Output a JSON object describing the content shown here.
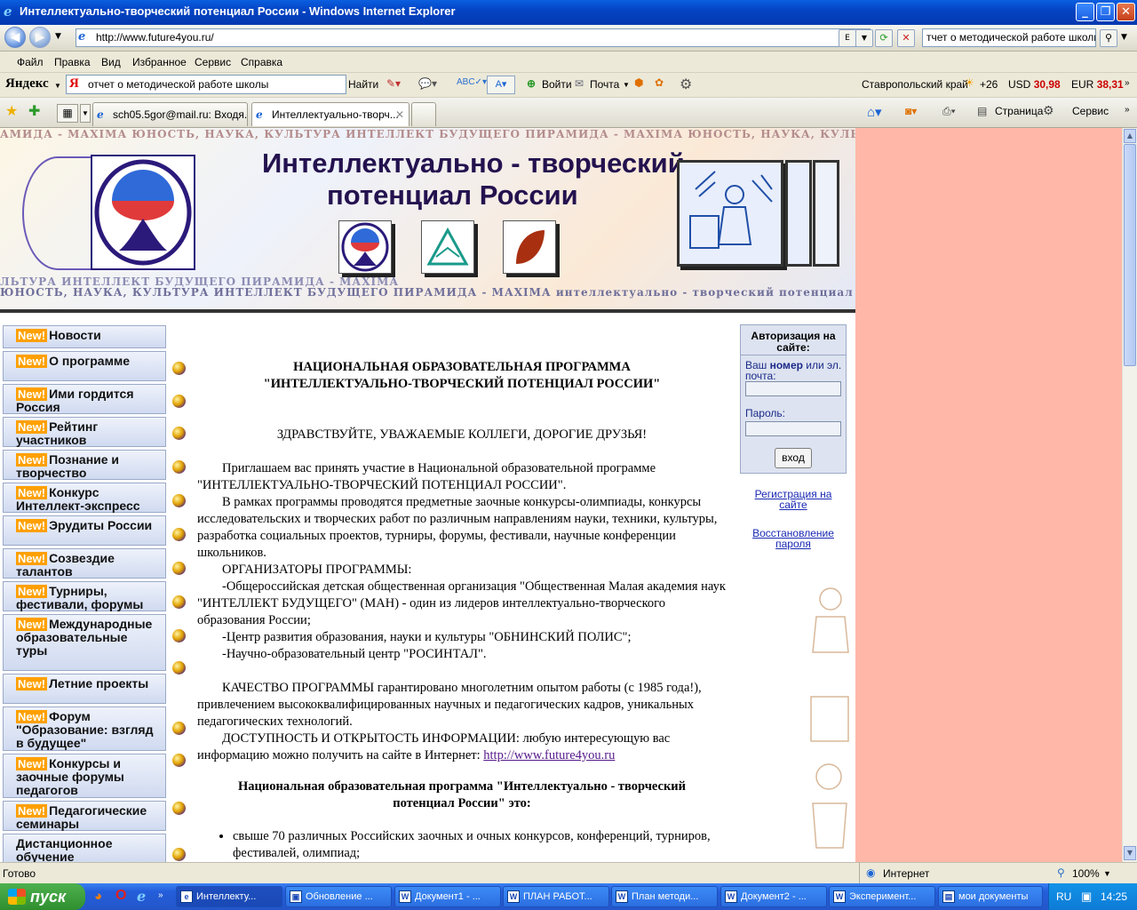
{
  "window": {
    "title": "Интеллектуально-творческий потенциал России - Windows Internet Explorer"
  },
  "address": {
    "url": "http://www.future4you.ru/",
    "search_value": "тчет о методической работе школы"
  },
  "menu": [
    "Файл",
    "Правка",
    "Вид",
    "Избранное",
    "Сервис",
    "Справка"
  ],
  "yandex": {
    "logo": "Яндекс",
    "query": "отчет о методической работе школы",
    "find_label": "Найти",
    "login_label": "Войти",
    "mail_label": "Почта",
    "region": "Ставропольский край",
    "temp": "+26",
    "usd_label": "USD",
    "usd_value": "30,98",
    "eur_label": "EUR",
    "eur_value": "38,31"
  },
  "tabs": [
    {
      "label": "sch05.5gor@mail.ru: Входя..."
    },
    {
      "label": "Интеллектуально-творч..."
    }
  ],
  "command_bar": {
    "page_label": "Страница",
    "tools_label": "Сервис"
  },
  "banner": {
    "title1": "Интеллектуально - творческий",
    "title2": "потенциал России",
    "strip_top": "АМИДА - МАХIМА   ЮНОСТЬ, НАУКА, КУЛЬТУРА   ИНТЕЛЛЕКТ БУДУЩЕГО   ПИРАМИДА - МАХIМА   ЮНОСТЬ, НАУКА, КУЛЬТУРА   ИНТЕЛЛЕКТ БУДУЩЕГО",
    "strip_bottom1": "ЛЬТУРА   ИНТЕЛЛЕКТ БУДУЩЕГО   ПИРАМИДА - МАХIМА",
    "strip_bottom2": "ЮНОСТЬ, НАУКА, КУЛЬТУРА   ИНТЕЛЛЕКТ БУДУЩЕГО   ПИРАМИДА - МАХIМА   интеллектуально - творческий потенциал"
  },
  "left_menu": [
    {
      "new": "New!",
      "label": "Новости"
    },
    {
      "new": "New!",
      "label": "О программе"
    },
    {
      "new": "New!",
      "label": "Ими гордится Россия"
    },
    {
      "new": "New!",
      "label": "Рейтинг участников"
    },
    {
      "new": "New!",
      "label": "Познание и творчество"
    },
    {
      "new": "New!",
      "label": "Конкурс Интеллект-экспресс"
    },
    {
      "new": "New!",
      "label": "Эрудиты России"
    },
    {
      "new": "New!",
      "label": "Созвездие талантов"
    },
    {
      "new": "New!",
      "label": "Турниры, фестивали, форумы"
    },
    {
      "new": "New!",
      "label": "Международные образовательные туры"
    },
    {
      "new": "New!",
      "label": "Летние проекты"
    },
    {
      "new": "New!",
      "label": "Форум \"Образование: взгляд в будущее\""
    },
    {
      "new": "New!",
      "label": "Конкурсы и заочные форумы педагогов"
    },
    {
      "new": "New!",
      "label": "Педагогические семинары"
    },
    {
      "new": "",
      "label": "Дистанционное обучение"
    }
  ],
  "main": {
    "heading1": "НАЦИОНАЛЬНАЯ ОБРАЗОВАТЕЛЬНАЯ ПРОГРАММА",
    "heading2": "\"ИНТЕЛЛЕКТУАЛЬНО-ТВОРЧЕСКИЙ ПОТЕНЦИАЛ РОССИИ\"",
    "greeting": "ЗДРАВСТВУЙТЕ, УВАЖАЕМЫЕ КОЛЛЕГИ, ДОРОГИЕ ДРУЗЬЯ!",
    "p1": "Приглашаем вас принять участие в Национальной образовательной программе \"ИНТЕЛЛЕКТУАЛЬНО-ТВОРЧЕСКИЙ ПОТЕНЦИАЛ РОССИИ\".",
    "p2": "В рамках программы проводятся предметные заочные конкурсы-олимпиады, конкурсы исследовательских и творческих работ по различным направлениям науки, техники, культуры, разработка социальных проектов, турниры, форумы, фестивали, научные конференции школьников.",
    "p3": "ОРГАНИЗАТОРЫ ПРОГРАММЫ:",
    "p4": "-Общероссийская детская общественная организация \"Общественная Малая академия наук \"ИНТЕЛЛЕКТ БУДУЩЕГО\" (МАН) - один из лидеров интеллектуально-творческого образования России;",
    "p5": "-Центр развития образования, науки и культуры \"ОБНИНСКИЙ ПОЛИС\";",
    "p6": "-Научно-образовательный центр \"РОСИНТАЛ\".",
    "p7": "КАЧЕСТВО ПРОГРАММЫ гарантировано многолетним опытом работы (с 1985 года!), привлечением высококвалифицированных научных и педагогических кадров, уникальных педагогических технологий.",
    "p8": "ДОСТУПНОСТЬ И ОТКРЫТОСТЬ ИНФОРМАЦИИ: любую интересующую вас информацию можно получить на сайте в Интернет: ",
    "p8_link": "http://www.future4you.ru",
    "heading3": "Национальная образовательная программа \"Интеллектуально - творческий потенциал России\" это:",
    "li1": "свыше 70 различных Российских заочных и очных конкурсов, конференций, турниров, фестивалей, олимпиад;"
  },
  "auth": {
    "title": "Авторизация на сайте:",
    "login_label_a": "Ваш ",
    "login_label_b": "номер",
    "login_label_c": " или эл. почта:",
    "password_label": "Пароль:",
    "submit": "вход",
    "register": "Регистрация на сайте",
    "restore": "Восстановление пароля"
  },
  "status": {
    "text": "Готово",
    "zone": "Интернет",
    "zoom": "100%"
  },
  "taskbar": {
    "start": "пуск",
    "items": [
      "Интеллекту...",
      "Обновление ...",
      "Документ1 - ...",
      "ПЛАН РАБОТ...",
      "План методи...",
      "Документ2 - ...",
      "Эксперимент...",
      "мои документы"
    ],
    "lang": "RU",
    "clock": "14:25"
  },
  "colors": {
    "accent": "#245edb",
    "page_bg": "#ffb8a8",
    "new_badge": "#ffa000"
  }
}
